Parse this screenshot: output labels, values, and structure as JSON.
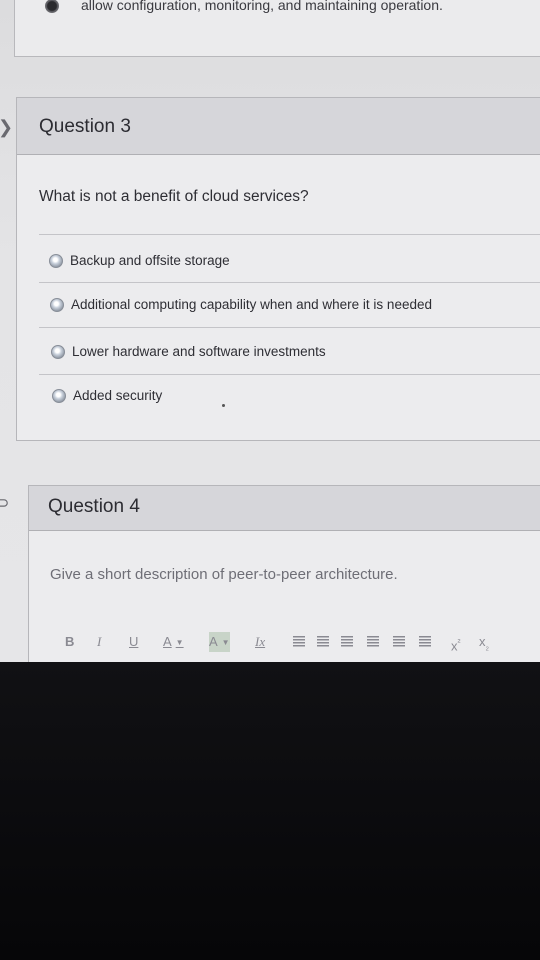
{
  "previous_question": {
    "selected_answer_text": "allow configuration, monitoring, and maintaining operation."
  },
  "question3": {
    "title": "Question 3",
    "prompt": "What is not a benefit of cloud services?",
    "options": [
      {
        "label": "Backup and offsite storage"
      },
      {
        "label": "Additional computing capability when and where it is needed"
      },
      {
        "label": "Lower hardware and software investments"
      },
      {
        "label": "Added security"
      }
    ]
  },
  "question4": {
    "title": "Question 4",
    "prompt": "Give a short description of peer-to-peer architecture.",
    "toolbar": {
      "bold": "B",
      "italic": "I",
      "underline": "U",
      "font_color": "A",
      "highlight": "A",
      "clear_format": "Ix",
      "superscript": "x",
      "subscript": "x"
    }
  },
  "colors": {
    "card_background": "#ececee",
    "header_background": "#d6d6da",
    "text": "#2e2e34"
  }
}
